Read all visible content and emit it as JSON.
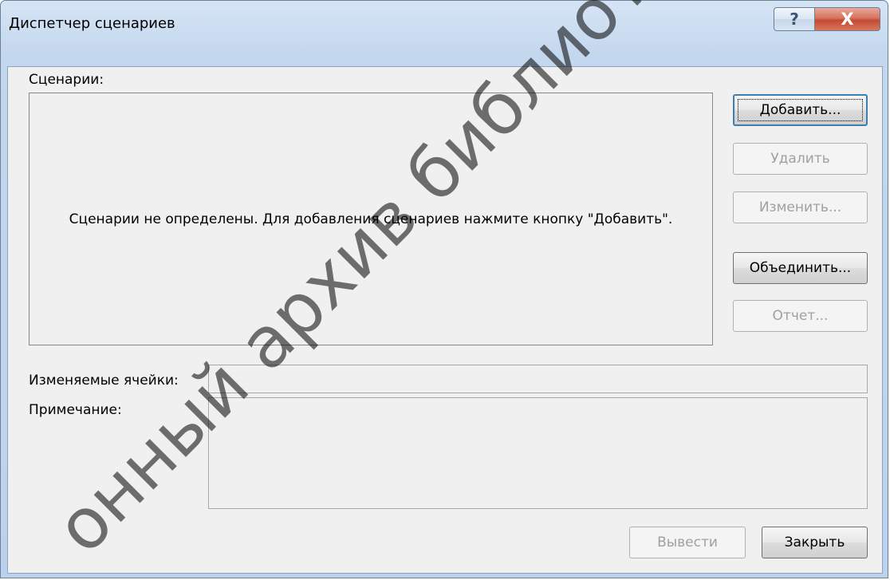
{
  "window": {
    "title": "Диспетчер сценариев",
    "help_glyph": "?",
    "close_glyph": "X"
  },
  "scenarios": {
    "label": "Сценарии:",
    "empty_message": "Сценарии не определены. Для добавления сценариев нажмите кнопку \"Добавить\"."
  },
  "buttons": {
    "add": "Добавить...",
    "delete": "Удалить",
    "edit": "Изменить...",
    "merge": "Объединить...",
    "report": "Отчет..."
  },
  "fields": {
    "changing_cells_label": "Изменяемые ячейки:",
    "changing_cells_value": "",
    "comment_label": "Примечание:",
    "comment_value": ""
  },
  "footer": {
    "show": "Вывести",
    "close": "Закрыть"
  },
  "watermark": {
    "text": "онный архив библиотеки"
  }
}
